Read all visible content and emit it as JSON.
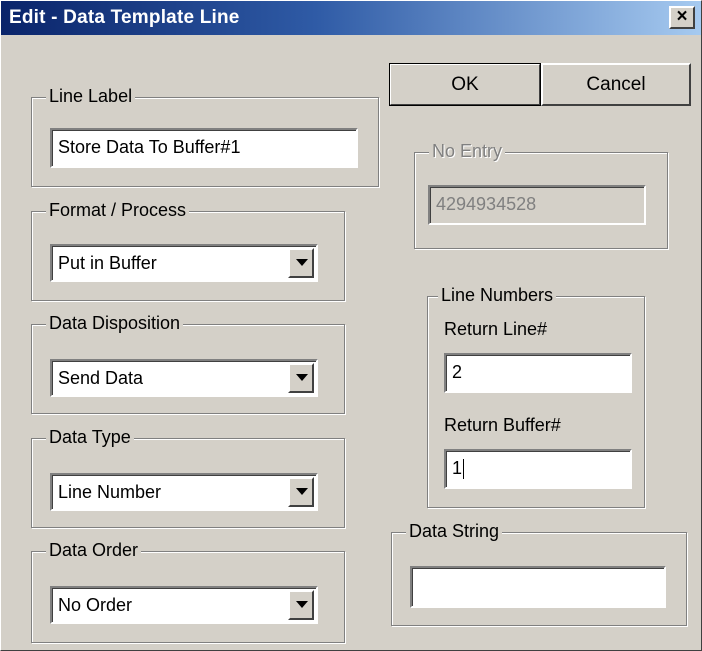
{
  "window": {
    "title": "Edit - Data Template Line",
    "close_glyph": "×",
    "close_icon": "close-icon"
  },
  "buttons": {
    "ok_label": "OK",
    "cancel_label": "Cancel"
  },
  "line_label": {
    "group_label": "Line Label",
    "value": "Store Data To Buffer#1"
  },
  "format_process": {
    "group_label": "Format / Process",
    "selected": "Put in Buffer"
  },
  "data_disposition": {
    "group_label": "Data Disposition",
    "selected": "Send Data"
  },
  "data_type": {
    "group_label": "Data Type",
    "selected": "Line Number"
  },
  "data_order": {
    "group_label": "Data Order",
    "selected": "No Order"
  },
  "no_entry": {
    "group_label": "No Entry",
    "value": "4294934528"
  },
  "line_numbers": {
    "group_label": "Line Numbers",
    "return_line_label": "Return Line#",
    "return_line_value": "2",
    "return_buffer_label": "Return Buffer#",
    "return_buffer_value": "1"
  },
  "data_string": {
    "group_label": "Data String",
    "value": ""
  }
}
